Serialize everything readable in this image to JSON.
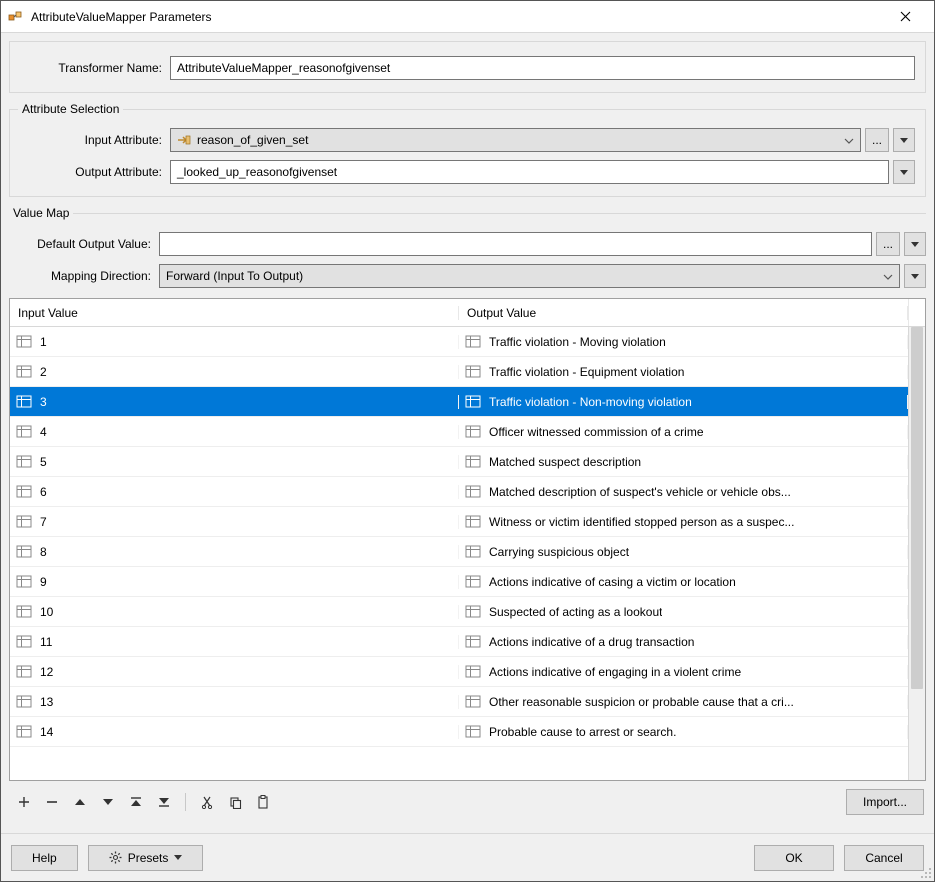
{
  "window": {
    "title": "AttributeValueMapper Parameters"
  },
  "form": {
    "transformer_name_label": "Transformer Name:",
    "transformer_name_value": "AttributeValueMapper_reasonofgivenset"
  },
  "attribute_selection": {
    "legend": "Attribute Selection",
    "input_label": "Input Attribute:",
    "input_value": "reason_of_given_set",
    "output_label": "Output Attribute:",
    "output_value": "_looked_up_reasonofgivenset"
  },
  "value_map": {
    "legend": "Value Map",
    "default_label": "Default Output Value:",
    "default_value": "",
    "direction_label": "Mapping Direction:",
    "direction_value": "Forward (Input To Output)",
    "column_input": "Input Value",
    "column_output": "Output Value",
    "selected_index": 2,
    "rows": [
      {
        "input": "1",
        "output": " Traffic violation - Moving violation"
      },
      {
        "input": "2",
        "output": "Traffic violation - Equipment violation"
      },
      {
        "input": "3",
        "output": "Traffic violation - Non-moving violation"
      },
      {
        "input": "4",
        "output": " Officer witnessed commission of a crime"
      },
      {
        "input": "5",
        "output": "Matched suspect description"
      },
      {
        "input": "6",
        "output": "Matched description of suspect's vehicle or vehicle obs..."
      },
      {
        "input": "7",
        "output": "Witness or victim identified stopped person as a suspec..."
      },
      {
        "input": "8",
        "output": "Carrying suspicious object"
      },
      {
        "input": "9",
        "output": "Actions indicative of casing a victim or location"
      },
      {
        "input": "10",
        "output": "Suspected of acting as a lookout"
      },
      {
        "input": "11",
        "output": "Actions indicative of a drug transaction"
      },
      {
        "input": "12",
        "output": "Actions indicative of engaging in a violent crime"
      },
      {
        "input": "13",
        "output": "Other reasonable suspicion or probable cause that a cri..."
      },
      {
        "input": "14",
        "output": " Probable cause to arrest or search."
      }
    ],
    "import_label": "Import...",
    "ellipsis_label": "..."
  },
  "footer": {
    "help": "Help",
    "presets": "Presets",
    "ok": "OK",
    "cancel": "Cancel"
  }
}
